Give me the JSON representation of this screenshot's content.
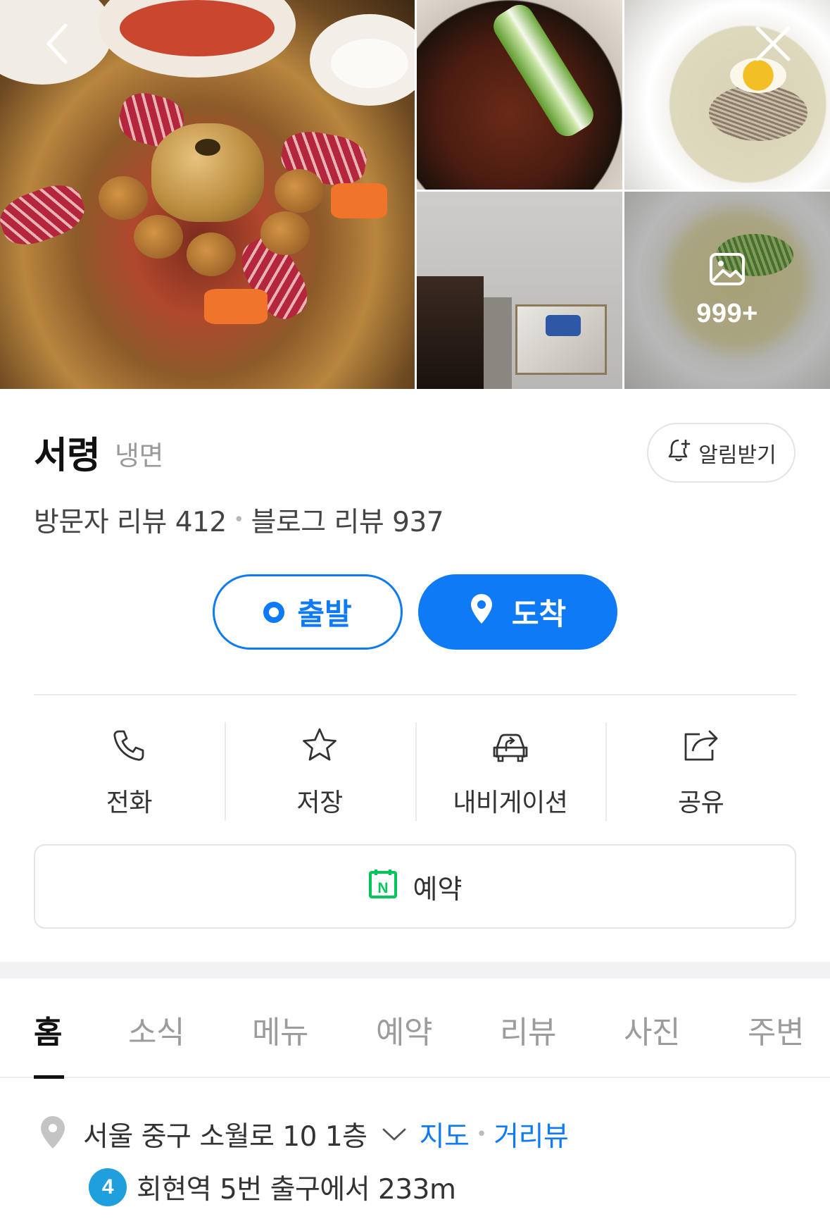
{
  "gallery": {
    "photo_count_badge": "999+",
    "photos": [
      {
        "name": "main-dish-photo"
      },
      {
        "name": "bulgogi-photo"
      },
      {
        "name": "naengmyeon-photo"
      },
      {
        "name": "entrance-photo"
      },
      {
        "name": "noodle-bowl-photo"
      }
    ]
  },
  "place": {
    "name": "서령",
    "category": "냉면",
    "alarm_label": "알림받기",
    "visitor_reviews": "방문자 리뷰 412",
    "blog_reviews": "블로그 리뷰 937",
    "separator": "•"
  },
  "directions": {
    "start_label": "출발",
    "end_label": "도착"
  },
  "actions": {
    "call": "전화",
    "save": "저장",
    "navigation": "내비게이션",
    "share": "공유"
  },
  "reservation": {
    "label": "예약",
    "icon_letter": "N"
  },
  "tabs": [
    {
      "label": "홈",
      "active": true
    },
    {
      "label": "소식"
    },
    {
      "label": "메뉴"
    },
    {
      "label": "예약"
    },
    {
      "label": "리뷰"
    },
    {
      "label": "사진"
    },
    {
      "label": "주변"
    }
  ],
  "address": {
    "text": "서울 중구 소월로 10 1층",
    "map_link": "지도",
    "street_view_link": "거리뷰",
    "separator": "•"
  },
  "subway": {
    "line": "4",
    "text": "회현역 5번 출구에서 233m",
    "line_color": "#1f9fdc"
  },
  "colors": {
    "accent": "#0e7af5",
    "reservation_green": "#03c75a"
  }
}
